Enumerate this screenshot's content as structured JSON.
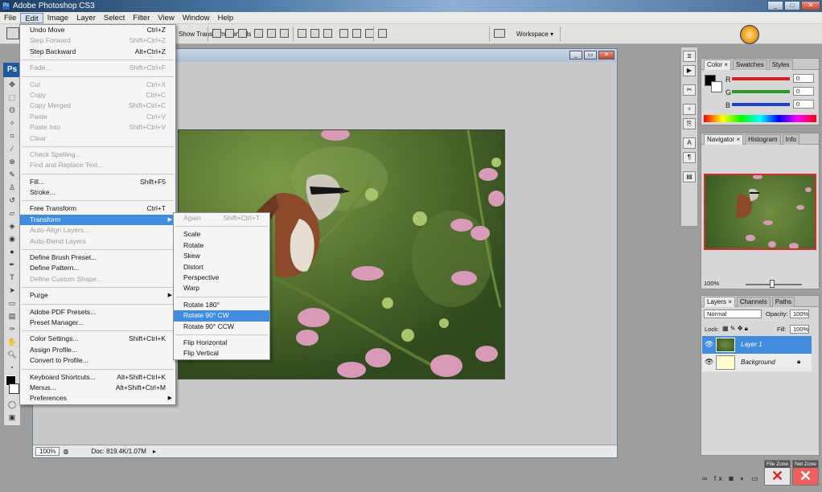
{
  "window": {
    "title": "Adobe Photoshop CS3",
    "icon": "photoshop-app-icon"
  },
  "menubar": [
    "File",
    "Edit",
    "Image",
    "Layer",
    "Select",
    "Filter",
    "View",
    "Window",
    "Help"
  ],
  "options_bar": {
    "show_controls": "Show Transform Controls",
    "workspace": "Workspace ▾"
  },
  "toolbox": {
    "logo": "Ps"
  },
  "edit_menu": [
    {
      "label": "Undo Move",
      "shortcut": "Ctrl+Z"
    },
    {
      "label": "Step Forward",
      "shortcut": "Shift+Ctrl+Z",
      "disabled": true
    },
    {
      "label": "Step Backward",
      "shortcut": "Alt+Ctrl+Z"
    },
    {
      "sep": true
    },
    {
      "label": "Fade...",
      "shortcut": "Shift+Ctrl+F",
      "disabled": true
    },
    {
      "sep": true
    },
    {
      "label": "Cut",
      "shortcut": "Ctrl+X",
      "disabled": true
    },
    {
      "label": "Copy",
      "shortcut": "Ctrl+C",
      "disabled": true
    },
    {
      "label": "Copy Merged",
      "shortcut": "Shift+Ctrl+C",
      "disabled": true
    },
    {
      "label": "Paste",
      "shortcut": "Ctrl+V",
      "disabled": true
    },
    {
      "label": "Paste Into",
      "shortcut": "Shift+Ctrl+V",
      "disabled": true
    },
    {
      "label": "Clear",
      "shortcut": "",
      "disabled": true
    },
    {
      "sep": true
    },
    {
      "label": "Check Spelling...",
      "shortcut": "",
      "disabled": true
    },
    {
      "label": "Find and Replace Text...",
      "shortcut": "",
      "disabled": true
    },
    {
      "sep": true
    },
    {
      "label": "Fill...",
      "shortcut": "Shift+F5"
    },
    {
      "label": "Stroke...",
      "shortcut": ""
    },
    {
      "sep": true
    },
    {
      "label": "Free Transform",
      "shortcut": "Ctrl+T"
    },
    {
      "label": "Transform",
      "shortcut": "",
      "submenu": true,
      "highlighted": true
    },
    {
      "label": "Auto-Align Layers...",
      "shortcut": "",
      "disabled": true
    },
    {
      "label": "Auto-Blend Layers",
      "shortcut": "",
      "disabled": true
    },
    {
      "sep": true
    },
    {
      "label": "Define Brush Preset...",
      "shortcut": ""
    },
    {
      "label": "Define Pattern...",
      "shortcut": ""
    },
    {
      "label": "Define Custom Shape...",
      "shortcut": "",
      "disabled": true
    },
    {
      "sep": true
    },
    {
      "label": "Purge",
      "shortcut": "",
      "submenu": true
    },
    {
      "sep": true
    },
    {
      "label": "Adobe PDF Presets...",
      "shortcut": ""
    },
    {
      "label": "Preset Manager...",
      "shortcut": ""
    },
    {
      "sep": true
    },
    {
      "label": "Color Settings...",
      "shortcut": "Shift+Ctrl+K"
    },
    {
      "label": "Assign Profile...",
      "shortcut": ""
    },
    {
      "label": "Convert to Profile...",
      "shortcut": ""
    },
    {
      "sep": true
    },
    {
      "label": "Keyboard Shortcuts...",
      "shortcut": "Alt+Shift+Ctrl+K"
    },
    {
      "label": "Menus...",
      "shortcut": "Alt+Shift+Ctrl+M"
    },
    {
      "label": "Preferences",
      "shortcut": "",
      "submenu": true
    }
  ],
  "transform_menu": [
    {
      "label": "Again",
      "shortcut": "Shift+Ctrl+T",
      "disabled": true
    },
    {
      "sep": true
    },
    {
      "label": "Scale"
    },
    {
      "label": "Rotate"
    },
    {
      "label": "Skew"
    },
    {
      "label": "Distort"
    },
    {
      "label": "Perspective"
    },
    {
      "label": "Warp"
    },
    {
      "sep": true
    },
    {
      "label": "Rotate 180°"
    },
    {
      "label": "Rotate 90° CW",
      "highlighted": true
    },
    {
      "label": "Rotate 90° CCW"
    },
    {
      "sep": true
    },
    {
      "label": "Flip Horizontal"
    },
    {
      "label": "Flip Vertical"
    }
  ],
  "document": {
    "zoom": "100%",
    "doc_info": "Doc: 819.4K/1.07M"
  },
  "color_panel": {
    "tabs": [
      "Color ×",
      "Swatches",
      "Styles"
    ],
    "channels": [
      {
        "label": "R",
        "value": "0",
        "color": "#d42020"
      },
      {
        "label": "G",
        "value": "0",
        "color": "#2a9a2a"
      },
      {
        "label": "B",
        "value": "0",
        "color": "#2040c8"
      }
    ]
  },
  "navigator_panel": {
    "tabs": [
      "Navigator ×",
      "Histogram",
      "Info"
    ],
    "zoom": "100%"
  },
  "layers_panel": {
    "tabs": [
      "Layers ×",
      "Channels",
      "Paths"
    ],
    "blend_mode": "Normal",
    "opacity_label": "Opacity:",
    "opacity": "100%",
    "lock_label": "Lock:",
    "fill_label": "Fill:",
    "fill": "100%",
    "layers": [
      {
        "name": "Layer 1",
        "selected": true
      },
      {
        "name": "Background",
        "selected": false
      }
    ]
  },
  "zones": {
    "file_zone": "File Zone",
    "net_zone": "Net Zone"
  }
}
